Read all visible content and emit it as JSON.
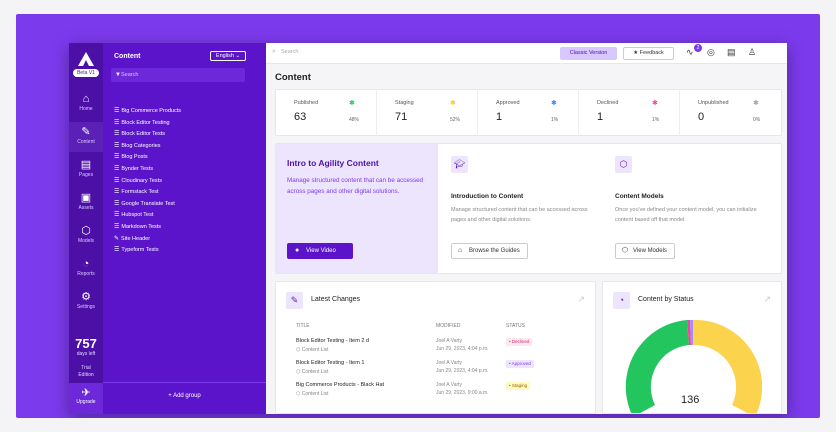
{
  "rail": {
    "version_badge": "Beta V1",
    "items": [
      {
        "icon": "home-icon",
        "glyph": "⌂",
        "label": "Home"
      },
      {
        "icon": "content-icon",
        "glyph": "✎",
        "label": "Content"
      },
      {
        "icon": "pages-icon",
        "glyph": "▤",
        "label": "Pages"
      },
      {
        "icon": "assets-icon",
        "glyph": "▣",
        "label": "Assets"
      },
      {
        "icon": "models-icon",
        "glyph": "⬡",
        "label": "Models"
      },
      {
        "icon": "reports-icon",
        "glyph": "◔",
        "label": "Reports"
      },
      {
        "icon": "settings-icon",
        "glyph": "⚙",
        "label": "Settings"
      }
    ],
    "days_left": "757",
    "days_left_label": "days left",
    "trial_line1": "Trial",
    "trial_line2": "Edition",
    "upgrade_label": "Upgrade"
  },
  "sidebar": {
    "title": "Content",
    "language": "English ⌄",
    "search_placeholder": "Search",
    "items": [
      "Big Commerce Products",
      "Block Editor Testing",
      "Block Editor Tests",
      "Blog Categories",
      "Blog Posts",
      "Bynder Tests",
      "Cloudinary Tests",
      "Formstack Test",
      "Google Translate Test",
      "Hubspot Test",
      "Markdown Tests",
      "Site Header",
      "Typeform Tests"
    ],
    "add_group": "+ Add group"
  },
  "topbar": {
    "search_placeholder": "Search",
    "classic_label": "Classic Version",
    "feedback_label": "Feedback",
    "notification_count": "2"
  },
  "page_title": "Content",
  "stats": [
    {
      "label": "Published",
      "value": "63",
      "pct": "48%",
      "color": "#22c55e"
    },
    {
      "label": "Staging",
      "value": "71",
      "pct": "52%",
      "color": "#facc15"
    },
    {
      "label": "Approved",
      "value": "1",
      "pct": "1%",
      "color": "#3b82f6"
    },
    {
      "label": "Declined",
      "value": "1",
      "pct": "1%",
      "color": "#ec4899"
    },
    {
      "label": "Unpublished",
      "value": "0",
      "pct": "0%",
      "color": "#9ca3af"
    }
  ],
  "intro": {
    "title": "Intro to Agility Content",
    "text": "Manage structured content that can be accessed across pages and other digital solutions.",
    "button": "View Video",
    "col1_title": "Introduction to Content",
    "col1_text": "Manage structured content that can be accessed across pages and other digital solutions.",
    "col1_button": "Browse the Guides",
    "col2_title": "Content Models",
    "col2_text": "Once you've defined your content model, you can initialize content based off that model.",
    "col2_button": "View Models"
  },
  "latest": {
    "title": "Latest Changes",
    "col_title": "TITLE",
    "col_modified": "MODIFIED",
    "col_status": "STATUS",
    "rows": [
      {
        "title": "Block Editor Testing - Item 2 d",
        "sub": "Content List",
        "by": "Joel A Varty",
        "date": "Jun 29, 2023, 4:04 p.m.",
        "status": "• Declined",
        "bg": "#fde7f0",
        "fg": "#db2777"
      },
      {
        "title": "Block Editor Testing - Item 1",
        "sub": "Content List",
        "by": "Joel A Varty",
        "date": "Jun 29, 2023, 4:04 p.m.",
        "status": "• Approved",
        "bg": "#ede5fd",
        "fg": "#7c3aed"
      },
      {
        "title": "Big Commerce Products - Black Hat",
        "sub": "Content List",
        "by": "Joel A Varty",
        "date": "Jun 29, 2023, 9:00 a.m.",
        "status": "• Staging",
        "bg": "#fef9c3",
        "fg": "#a16207"
      }
    ]
  },
  "status_card": {
    "title": "Content by Status",
    "total": "136"
  }
}
